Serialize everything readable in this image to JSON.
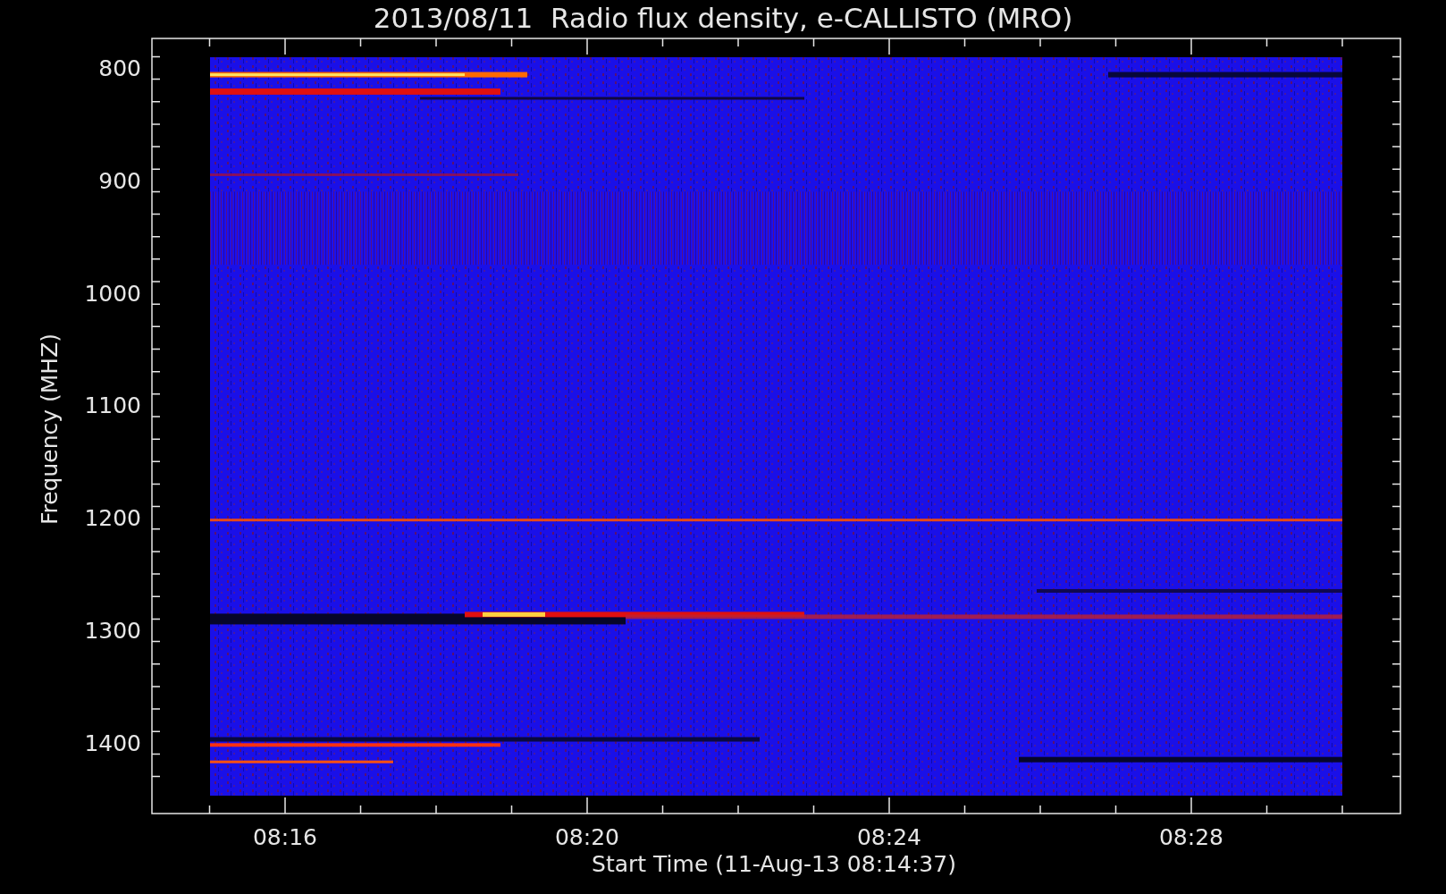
{
  "title": "2013/08/11  Radio flux density, e-CALLISTO (MRO)",
  "y_axis": {
    "label": "Frequency (MHZ)",
    "ticks": [
      "800",
      "900",
      "1000",
      "1100",
      "1200",
      "1300",
      "1400"
    ]
  },
  "x_axis": {
    "label": "Start Time (11-Aug-13 08:14:37)",
    "ticks": [
      "08:16",
      "08:20",
      "08:24",
      "08:28"
    ]
  }
}
